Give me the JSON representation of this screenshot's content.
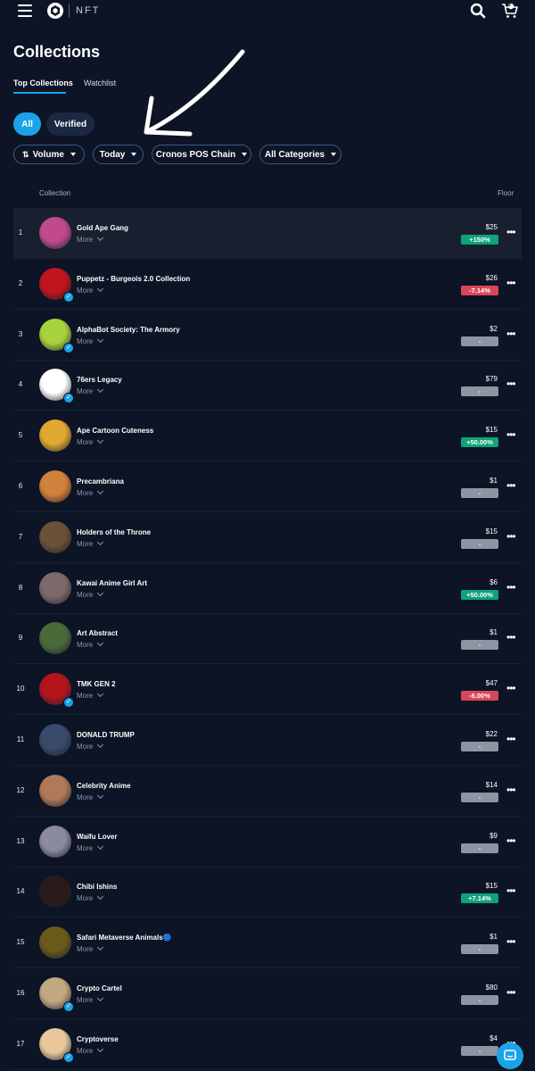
{
  "header": {
    "brand_label": "NFT",
    "cart_count": "0"
  },
  "page": {
    "title": "Collections",
    "tabs": [
      {
        "label": "Top Collections",
        "active": true
      },
      {
        "label": "Watchlist",
        "active": false
      }
    ],
    "pills": [
      {
        "label": "All",
        "active": true
      },
      {
        "label": "Verified",
        "active": false
      }
    ],
    "filters": {
      "sort": "Volume",
      "period": "Today",
      "chain": "Cronos POS Chain",
      "category": "All Categories"
    },
    "columns": {
      "collection": "Collection",
      "floor": "Floor"
    },
    "more_label": "More"
  },
  "collections": [
    {
      "rank": "1",
      "name": "Gold Ape Gang",
      "floor": "$25",
      "change": "+150%",
      "trend": "pos",
      "verified": false,
      "color": "#c04a8c"
    },
    {
      "rank": "2",
      "name": "Puppetz - Burgeois 2.0 Collection",
      "floor": "$26",
      "change": "-7.14%",
      "trend": "neg",
      "verified": true,
      "color": "#c0141e"
    },
    {
      "rank": "3",
      "name": "AlphaBot Society: The Armory",
      "floor": "$2",
      "change": "-",
      "trend": "none",
      "verified": true,
      "color": "#a8d23c"
    },
    {
      "rank": "4",
      "name": "76ers Legacy",
      "floor": "$79",
      "change": "-",
      "trend": "none",
      "verified": true,
      "color": "#ffffff"
    },
    {
      "rank": "5",
      "name": "Ape Cartoon Cuteness",
      "floor": "$15",
      "change": "+50.00%",
      "trend": "pos",
      "verified": false,
      "color": "#e0a830"
    },
    {
      "rank": "6",
      "name": "Precambriana",
      "floor": "$1",
      "change": "-",
      "trend": "none",
      "verified": false,
      "color": "#d2813a"
    },
    {
      "rank": "7",
      "name": "Holders of the Throne",
      "floor": "$15",
      "change": "-",
      "trend": "none",
      "verified": false,
      "color": "#6b5236"
    },
    {
      "rank": "8",
      "name": "Kawai Anime Girl Art",
      "floor": "$6",
      "change": "+50.00%",
      "trend": "pos",
      "verified": false,
      "color": "#7e6a6a"
    },
    {
      "rank": "9",
      "name": "Art Abstract",
      "floor": "$1",
      "change": "-",
      "trend": "none",
      "verified": false,
      "color": "#4a6a3a"
    },
    {
      "rank": "10",
      "name": "TMK GEN 2",
      "floor": "$47",
      "change": "-6.00%",
      "trend": "neg",
      "verified": true,
      "color": "#b3141c"
    },
    {
      "rank": "11",
      "name": "DONALD TRUMP",
      "floor": "$22",
      "change": "-",
      "trend": "none",
      "verified": false,
      "color": "#3a4a6a"
    },
    {
      "rank": "12",
      "name": "Celebrity Anime",
      "floor": "$14",
      "change": "-",
      "trend": "none",
      "verified": false,
      "color": "#b07a5a"
    },
    {
      "rank": "13",
      "name": "Waifu Lover",
      "floor": "$9",
      "change": "-",
      "trend": "none",
      "verified": false,
      "color": "#8a8aa0"
    },
    {
      "rank": "14",
      "name": "Chibi Ishins",
      "floor": "$15",
      "change": "+7.14%",
      "trend": "pos",
      "verified": false,
      "color": "#2a1a1a"
    },
    {
      "rank": "15",
      "name": "Safari Metaverse Animals🔵",
      "floor": "$1",
      "change": "-",
      "trend": "none",
      "verified": false,
      "color": "#6a5a1a"
    },
    {
      "rank": "16",
      "name": "Crypto Cartel",
      "floor": "$80",
      "change": "-",
      "trend": "none",
      "verified": true,
      "color": "#c2a880"
    },
    {
      "rank": "17",
      "name": "Cryptoverse",
      "floor": "$4",
      "change": "-",
      "trend": "none",
      "verified": true,
      "color": "#e8c89a"
    }
  ]
}
